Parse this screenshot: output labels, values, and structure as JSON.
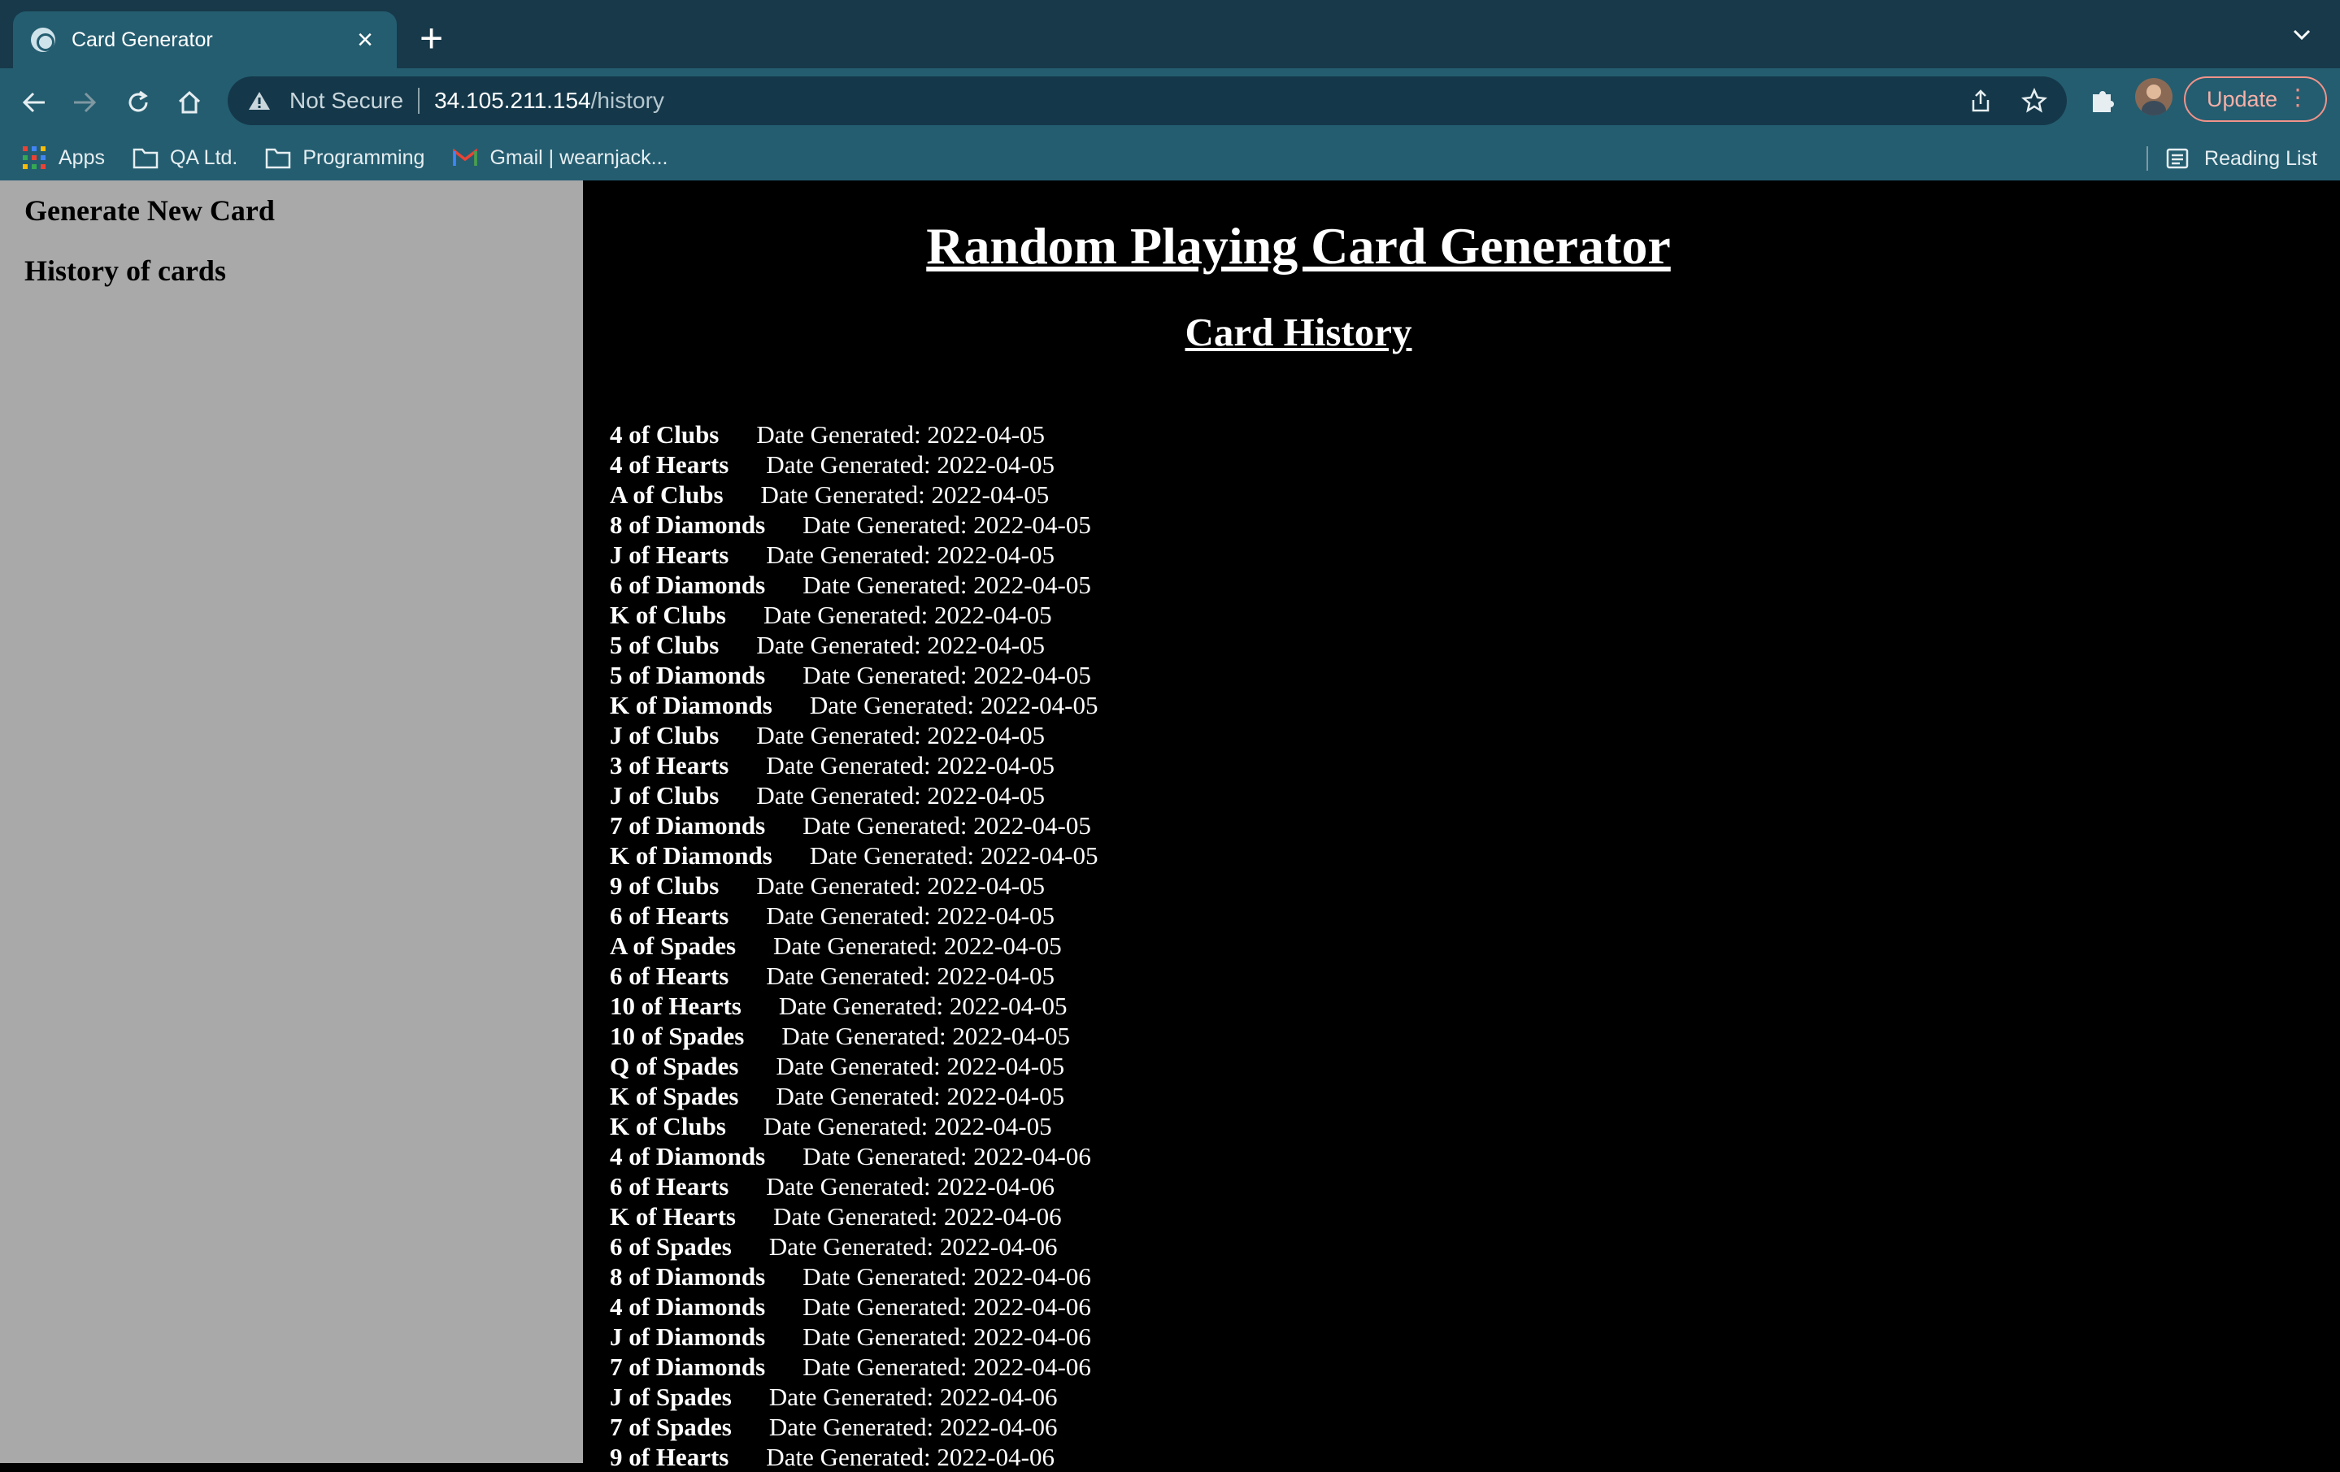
{
  "browser": {
    "tab_title": "Card Generator",
    "security_label": "Not Secure",
    "url_host": "34.105.211.154",
    "url_path": "/history",
    "update_label": "Update",
    "bookmarks": [
      "Apps",
      "QA Ltd.",
      "Programming",
      "Gmail | wearnjack..."
    ],
    "reading_list_label": "Reading List"
  },
  "sidebar": {
    "generate_link": "Generate New Card",
    "history_link": "History of cards"
  },
  "main": {
    "title": "Random Playing Card Generator",
    "subtitle": "Card History",
    "date_prefix": "Date Generated:",
    "history": [
      {
        "card": "4 of Clubs",
        "date": "2022-04-05"
      },
      {
        "card": "4 of Hearts",
        "date": "2022-04-05"
      },
      {
        "card": "A of Clubs",
        "date": "2022-04-05"
      },
      {
        "card": "8 of Diamonds",
        "date": "2022-04-05"
      },
      {
        "card": "J of Hearts",
        "date": "2022-04-05"
      },
      {
        "card": "6 of Diamonds",
        "date": "2022-04-05"
      },
      {
        "card": "K of Clubs",
        "date": "2022-04-05"
      },
      {
        "card": "5 of Clubs",
        "date": "2022-04-05"
      },
      {
        "card": "5 of Diamonds",
        "date": "2022-04-05"
      },
      {
        "card": "K of Diamonds",
        "date": "2022-04-05"
      },
      {
        "card": "J of Clubs",
        "date": "2022-04-05"
      },
      {
        "card": "3 of Hearts",
        "date": "2022-04-05"
      },
      {
        "card": "J of Clubs",
        "date": "2022-04-05"
      },
      {
        "card": "7 of Diamonds",
        "date": "2022-04-05"
      },
      {
        "card": "K of Diamonds",
        "date": "2022-04-05"
      },
      {
        "card": "9 of Clubs",
        "date": "2022-04-05"
      },
      {
        "card": "6 of Hearts",
        "date": "2022-04-05"
      },
      {
        "card": "A of Spades",
        "date": "2022-04-05"
      },
      {
        "card": "6 of Hearts",
        "date": "2022-04-05"
      },
      {
        "card": "10 of Hearts",
        "date": "2022-04-05"
      },
      {
        "card": "10 of Spades",
        "date": "2022-04-05"
      },
      {
        "card": "Q of Spades",
        "date": "2022-04-05"
      },
      {
        "card": "K of Spades",
        "date": "2022-04-05"
      },
      {
        "card": "K of Clubs",
        "date": "2022-04-05"
      },
      {
        "card": "4 of Diamonds",
        "date": "2022-04-06"
      },
      {
        "card": "6 of Hearts",
        "date": "2022-04-06"
      },
      {
        "card": "K of Hearts",
        "date": "2022-04-06"
      },
      {
        "card": "6 of Spades",
        "date": "2022-04-06"
      },
      {
        "card": "8 of Diamonds",
        "date": "2022-04-06"
      },
      {
        "card": "4 of Diamonds",
        "date": "2022-04-06"
      },
      {
        "card": "J of Diamonds",
        "date": "2022-04-06"
      },
      {
        "card": "7 of Diamonds",
        "date": "2022-04-06"
      },
      {
        "card": "J of Spades",
        "date": "2022-04-06"
      },
      {
        "card": "7 of Spades",
        "date": "2022-04-06"
      },
      {
        "card": "9 of Hearts",
        "date": "2022-04-06"
      }
    ]
  }
}
